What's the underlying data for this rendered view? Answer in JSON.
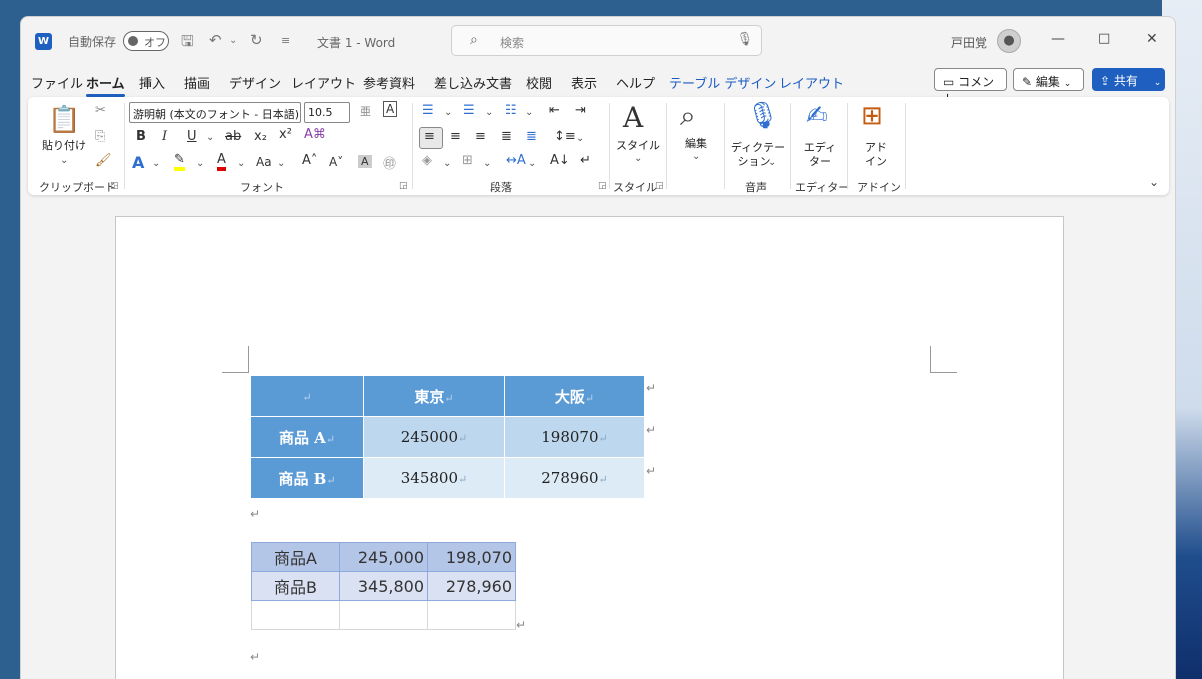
{
  "app": {
    "autosave_label": "自動保存",
    "autosave_state": "オフ",
    "doc_title": "文書 1  -  Word",
    "search_placeholder": "検索",
    "user_name": "戸田覚"
  },
  "menu": {
    "tabs": [
      "ファイル",
      "ホーム",
      "挿入",
      "描画",
      "デザイン",
      "レイアウト",
      "参考資料",
      "差し込み文書",
      "校閲",
      "表示",
      "ヘルプ"
    ],
    "context_tabs": [
      "テーブル デザイン",
      "レイアウト"
    ],
    "active_tab": "ホーム",
    "comment_button": "コメント",
    "edit_button": "編集",
    "share_button": "共有"
  },
  "ribbon": {
    "clipboard": {
      "paste_label": "貼り付け",
      "group_label": "クリップボード"
    },
    "font": {
      "font_name": "游明朝 (本文のフォント - 日本語)",
      "font_size": "10.5",
      "group_label": "フォント"
    },
    "paragraph": {
      "group_label": "段落"
    },
    "styles": {
      "button_label": "スタイル",
      "group_label": "スタイル"
    },
    "editing": {
      "button_label": "編集"
    },
    "voice": {
      "dictation_line1": "ディクテー",
      "dictation_line2": "ション",
      "group_label": "音声"
    },
    "editor": {
      "line1": "エディ",
      "line2": "ター",
      "group_label": "エディター"
    },
    "addins": {
      "line1": "アド",
      "line2": "イン",
      "group_label": "アドイン"
    }
  },
  "document": {
    "table1": {
      "headers": [
        "",
        "東京",
        "大阪"
      ],
      "rows": [
        {
          "label": "商品 A",
          "values": [
            "245000",
            "198070"
          ]
        },
        {
          "label": "商品 B",
          "values": [
            "345800",
            "278960"
          ]
        }
      ]
    },
    "table2": {
      "rows": [
        {
          "label": "商品A",
          "values": [
            "245,000",
            "198,070"
          ]
        },
        {
          "label": "商品B",
          "values": [
            "345,800",
            "278,960"
          ]
        }
      ]
    }
  },
  "colors": {
    "accent": "#1f5fbf",
    "table1_header": "#5b9bd5",
    "table1_row1": "#bdd7ee",
    "table1_row2": "#ddebf7",
    "table2_row1": "#b4c6e7",
    "table2_row2": "#d9e1f2"
  }
}
